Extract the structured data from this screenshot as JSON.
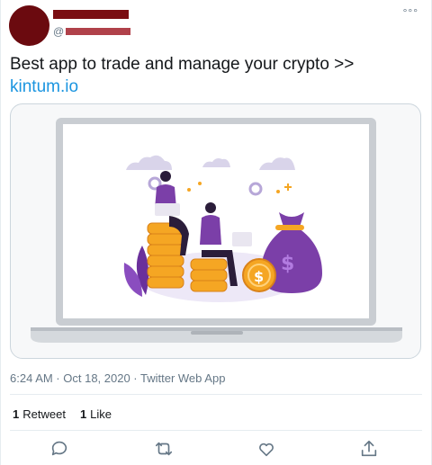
{
  "tweet": {
    "handle_prefix": "@",
    "more_glyph": "°°°",
    "text": "Best app to trade and manage your crypto >>",
    "link": "kintum.io",
    "timestamp": "6:24 AM · Oct 18, 2020 · Twitter Web App"
  },
  "stats": {
    "retweets_count": "1",
    "retweets_label": "Retweet",
    "likes_count": "1",
    "likes_label": "Like"
  },
  "actions": {
    "reply_icon": "reply-icon",
    "retweet_icon": "retweet-icon",
    "like_icon": "heart-icon",
    "share_icon": "share-icon"
  },
  "colors": {
    "link": "#1b95e0",
    "secondary_text": "#657786",
    "avatar": "#6b0a0f",
    "illustration_purple": "#7b3fa8",
    "coin_orange": "#f5a623"
  }
}
